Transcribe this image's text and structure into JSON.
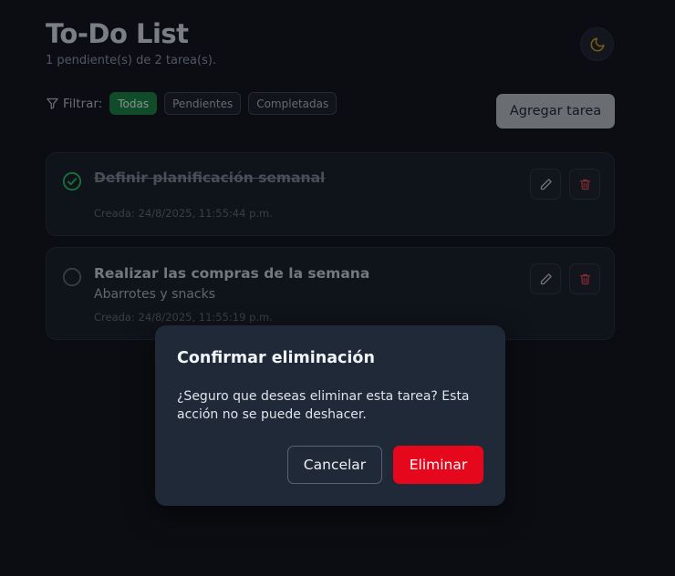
{
  "header": {
    "title": "To-Do List",
    "subtitle": "1 pendiente(s) de 2 tarea(s)."
  },
  "filters": {
    "label": "Filtrar:",
    "options": [
      "Todas",
      "Pendientes",
      "Completadas"
    ],
    "selected": "Todas"
  },
  "add_button_label": "Agregar tarea",
  "tasks": [
    {
      "title": "Definir planificación semanal",
      "description": "",
      "created": "Creada: 24/8/2025, 11:55:44 p.m.",
      "completed": true
    },
    {
      "title": "Realizar las compras de la semana",
      "description": "Abarrotes y snacks",
      "created": "Creada: 24/8/2025, 11:55:19 p.m.",
      "completed": false
    }
  ],
  "modal": {
    "title": "Confirmar eliminación",
    "message": "¿Seguro que deseas eliminar esta tarea? Esta acción no se puede deshacer.",
    "cancel_label": "Cancelar",
    "confirm_label": "Eliminar"
  },
  "colors": {
    "background": "#0b0d12",
    "accent_green": "#15803d",
    "danger_red": "#e5071b",
    "modal_bg": "#1f2937",
    "theme_icon": "#d4a017"
  },
  "icons": {
    "theme_toggle": "moon-icon",
    "filter": "filter-icon",
    "edit": "pencil-icon",
    "delete": "trash-icon",
    "completed": "check-circle-icon",
    "pending": "circle-icon"
  }
}
